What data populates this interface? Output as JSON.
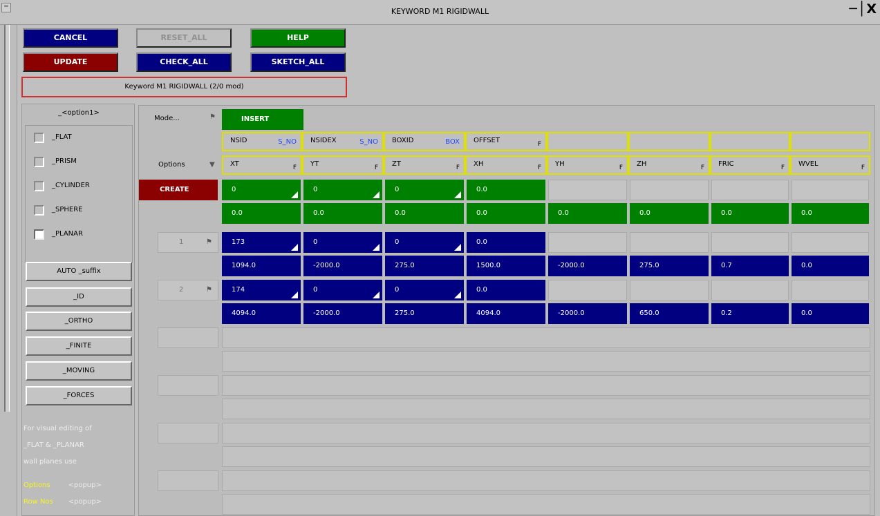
{
  "window": {
    "title": "KEYWORD M1 RIGIDWALL",
    "controls": "─│X",
    "sys_icon": "━"
  },
  "toolbar": {
    "cancel": "CANCEL",
    "reset_all": "RESET_ALL",
    "help": "HELP",
    "update": "UPDATE",
    "check_all": "CHECK_ALL",
    "sketch_all": "SKETCH_ALL",
    "status": "Keyword M1 RIGIDWALL (2/0 mod)"
  },
  "options": {
    "heading": "_<option1>",
    "items": [
      {
        "label": "_FLAT",
        "checked": false
      },
      {
        "label": "_PRISM",
        "checked": false
      },
      {
        "label": "_CYLINDER",
        "checked": false
      },
      {
        "label": "_SPHERE",
        "checked": false
      },
      {
        "label": "_PLANAR",
        "checked": true
      }
    ],
    "buttons": [
      "AUTO _suffix",
      "_ID",
      "_ORTHO",
      "_FINITE",
      "_MOVING",
      "_FORCES"
    ],
    "note": [
      "For visual editing of",
      "_FLAT & _PLANAR",
      "wall planes use"
    ],
    "popups": [
      {
        "label": "Options",
        "value": "<popup>"
      },
      {
        "label": "Row Nos",
        "value": "<popup>"
      }
    ]
  },
  "grid": {
    "mode_label": "Mode...",
    "mode_value": "INSERT",
    "options_label": "Options",
    "create": "CREATE",
    "header1": [
      {
        "name": "NSID",
        "tag": "S_NO"
      },
      {
        "name": "NSIDEX",
        "tag": "S_NO"
      },
      {
        "name": "BOXID",
        "tag": "BOX"
      },
      {
        "name": "OFFSET",
        "tag": "F"
      }
    ],
    "header2": [
      {
        "name": "XT",
        "tag": "F"
      },
      {
        "name": "YT",
        "tag": "F"
      },
      {
        "name": "ZT",
        "tag": "F"
      },
      {
        "name": "XH",
        "tag": "F"
      },
      {
        "name": "YH",
        "tag": "F"
      },
      {
        "name": "ZH",
        "tag": "F"
      },
      {
        "name": "FRIC",
        "tag": "F"
      },
      {
        "name": "WVEL",
        "tag": "F"
      }
    ],
    "default_row1": [
      "0",
      "0",
      "0",
      "0.0"
    ],
    "default_row2": [
      "0.0",
      "0.0",
      "0.0",
      "0.0",
      "0.0",
      "0.0",
      "0.0",
      "0.0"
    ],
    "rows": [
      {
        "num": "1",
        "row1": [
          "173",
          "0",
          "0",
          "0.0"
        ],
        "row2": [
          "1094.0",
          "-2000.0",
          "275.0",
          "1500.0",
          "-2000.0",
          "275.0",
          "0.7",
          "0.0"
        ]
      },
      {
        "num": "2",
        "row1": [
          "174",
          "0",
          "0",
          "0.0"
        ],
        "row2": [
          "4094.0",
          "-2000.0",
          "275.0",
          "4094.0",
          "-2000.0",
          "650.0",
          "0.2",
          "0.0"
        ]
      }
    ]
  },
  "colors": {
    "blue": "#000080",
    "green": "#008000",
    "red": "#8b0000",
    "yellow_border": "#e0e000"
  }
}
